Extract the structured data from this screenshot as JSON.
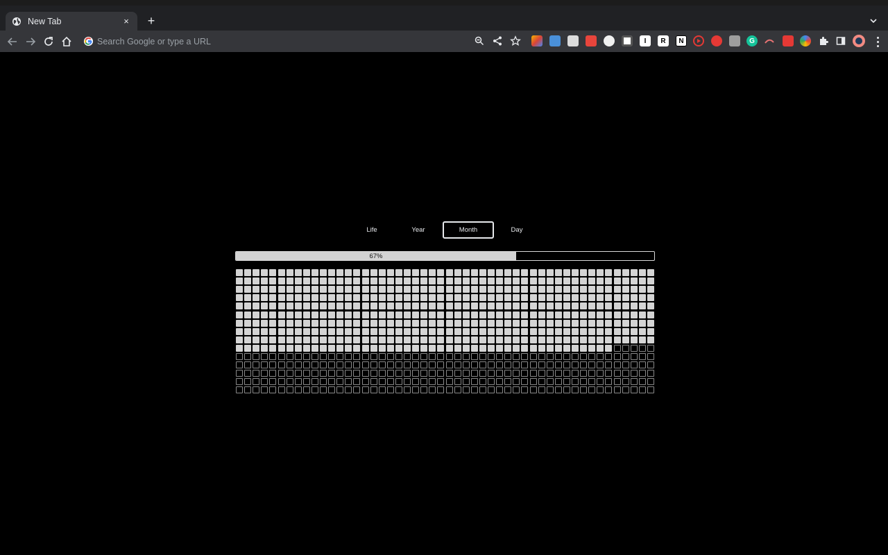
{
  "browser": {
    "tab": {
      "title": "New Tab",
      "favicon": "globe-icon",
      "close_label": "×"
    },
    "new_tab_label": "+",
    "omnibox": {
      "placeholder": "Search Google or type a URL",
      "value": ""
    },
    "extensions": [
      "ext-icon-1",
      "ext-icon-2",
      "ext-icon-3",
      "ext-icon-4",
      "ext-icon-5",
      "ext-icon-6",
      "ext-icon-I",
      "ext-icon-R",
      "ext-icon-N",
      "ext-icon-play",
      "ext-icon-red",
      "ext-icon-gray",
      "ext-icon-grammarly",
      "ext-icon-swoosh",
      "ext-icon-dice",
      "ext-icon-colorwheel",
      "extensions-puzzle-icon",
      "side-panel-icon"
    ],
    "extension_letters": {
      "i": "I",
      "r": "R",
      "n": "N",
      "grammarly": "G"
    }
  },
  "modes": [
    {
      "label": "Life",
      "active": false
    },
    {
      "label": "Year",
      "active": false
    },
    {
      "label": "Month",
      "active": true
    },
    {
      "label": "Day",
      "active": false
    }
  ],
  "progress": {
    "percent": 67,
    "label": "67%"
  },
  "grid": {
    "columns": 50,
    "rows": 15,
    "filled_count": 495,
    "colors": {
      "filled": "#d4d4d4",
      "empty_border": "#8a8a8a",
      "background": "#000000"
    }
  }
}
